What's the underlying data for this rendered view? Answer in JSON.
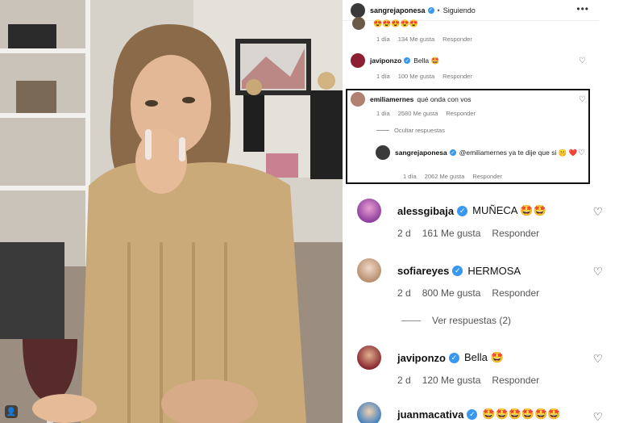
{
  "header": {
    "username": "sangrejaponesa",
    "separator": "•",
    "follow_label": "Siguiendo",
    "more_icon": "more-icon"
  },
  "top_comments": [
    {
      "username": "",
      "text": "😍😍😍😍😍",
      "time": "1 día",
      "likes": "134 Me gusta",
      "reply": "Responder"
    },
    {
      "username": "javiponzo",
      "verified": true,
      "text": "Bella 🤩",
      "time": "1 día",
      "likes": "100 Me gusta",
      "reply": "Responder"
    },
    {
      "username": "emiliamernes",
      "text": "qué onda con vos",
      "time": "1 día",
      "likes": "2580 Me gusta",
      "reply": "Responder"
    }
  ],
  "hide_replies_label": "Ocultar respuestas",
  "reply": {
    "username": "sangrejaponesa",
    "verified": true,
    "text": "@emiliamernes ya te dije que si 🤫 ❤️",
    "time": "1 día",
    "likes": "2062 Me gusta",
    "reply": "Responder"
  },
  "comments": [
    {
      "username": "alessgibaja",
      "verified": true,
      "text": "MUÑECA 🤩🤩",
      "time": "2 d",
      "likes": "161 Me gusta",
      "reply": "Responder"
    },
    {
      "username": "sofiareyes",
      "verified": true,
      "text": "HERMOSA",
      "time": "2 d",
      "likes": "800 Me gusta",
      "reply": "Responder"
    },
    {
      "username": "javiponzo",
      "verified": true,
      "text": "Bella 🤩",
      "time": "2 d",
      "likes": "120 Me gusta",
      "reply": "Responder"
    },
    {
      "username": "juanmacativa",
      "verified": true,
      "text": "🤩🤩🤩🤩🤩🤩"
    }
  ],
  "view_replies_label": "Ver respuestas (2)",
  "colors": {
    "verified": "#3897f0",
    "highlight_border": "#111111"
  }
}
